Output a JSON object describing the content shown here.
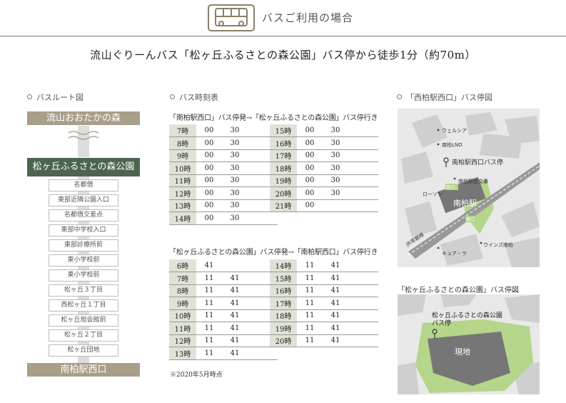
{
  "header": {
    "title": "バスご利用の場合"
  },
  "headline": "流山ぐりーんバス「松ヶ丘ふるさとの森公園」バス停から徒歩1分（約70m）",
  "route": {
    "title": "バスルート図",
    "start": "流山おおたかの森",
    "highlight": "松ヶ丘ふるさとの森公園",
    "stops": [
      "名都借",
      "東部近隣公園入口",
      "名都借交差点",
      "東部中学校入口",
      "東部診療所前",
      "東小学校前",
      "東小学校前",
      "松ヶ丘３丁目",
      "西松ヶ丘１丁目",
      "松ヶ丘旭会館前",
      "松ヶ丘２丁目",
      "松ヶ丘団地"
    ],
    "end": "南柏駅西口"
  },
  "timetable": {
    "title": "バス時刻表",
    "outbound_caption": "「南柏駅西口」バス停発→「松ヶ丘ふるさとの森公園」バス停行き",
    "outbound_left": [
      {
        "hour": "7時",
        "m1": "00",
        "m2": "30"
      },
      {
        "hour": "8時",
        "m1": "00",
        "m2": "30"
      },
      {
        "hour": "9時",
        "m1": "00",
        "m2": "30"
      },
      {
        "hour": "10時",
        "m1": "00",
        "m2": "30"
      },
      {
        "hour": "11時",
        "m1": "00",
        "m2": "30"
      },
      {
        "hour": "12時",
        "m1": "00",
        "m2": "30"
      },
      {
        "hour": "13時",
        "m1": "00",
        "m2": "30"
      },
      {
        "hour": "14時",
        "m1": "00",
        "m2": "30"
      }
    ],
    "outbound_right": [
      {
        "hour": "15時",
        "m1": "00",
        "m2": "30"
      },
      {
        "hour": "16時",
        "m1": "00",
        "m2": "30"
      },
      {
        "hour": "17時",
        "m1": "00",
        "m2": "30"
      },
      {
        "hour": "18時",
        "m1": "00",
        "m2": "30"
      },
      {
        "hour": "19時",
        "m1": "00",
        "m2": "30"
      },
      {
        "hour": "20時",
        "m1": "00",
        "m2": "30"
      },
      {
        "hour": "21時",
        "m1": "00",
        "m2": ""
      }
    ],
    "inbound_caption": "「松ヶ丘ふるさとの森公園」バス停発→「南柏駅西口」バス停行き",
    "inbound_left": [
      {
        "hour": "6時",
        "m1": "41",
        "m2": ""
      },
      {
        "hour": "7時",
        "m1": "11",
        "m2": "41"
      },
      {
        "hour": "8時",
        "m1": "11",
        "m2": "41"
      },
      {
        "hour": "9時",
        "m1": "11",
        "m2": "41"
      },
      {
        "hour": "10時",
        "m1": "11",
        "m2": "41"
      },
      {
        "hour": "11時",
        "m1": "11",
        "m2": "41"
      },
      {
        "hour": "12時",
        "m1": "11",
        "m2": "41"
      },
      {
        "hour": "13時",
        "m1": "11",
        "m2": "41"
      }
    ],
    "inbound_right": [
      {
        "hour": "14時",
        "m1": "11",
        "m2": "41"
      },
      {
        "hour": "15時",
        "m1": "11",
        "m2": "41"
      },
      {
        "hour": "16時",
        "m1": "11",
        "m2": "41"
      },
      {
        "hour": "17時",
        "m1": "11",
        "m2": "41"
      },
      {
        "hour": "18時",
        "m1": "11",
        "m2": "41"
      },
      {
        "hour": "19時",
        "m1": "11",
        "m2": "41"
      },
      {
        "hour": "20時",
        "m1": "11",
        "m2": "41"
      }
    ],
    "footnote": "※2020年5月時点"
  },
  "map1": {
    "title": "「西柏駅西口」バス停図",
    "labels": {
      "wellsia": "ウェルシア",
      "minamikashiwa_no": "南柏LNO",
      "bus_stop": "南柏駅西口バス停",
      "crossing": "南柏駅前交番",
      "lawson": "ローソン",
      "west": "西口",
      "station": "南柏駅",
      "east": "東口",
      "jr": "JR常磐線",
      "winds": "ウインズ南柏",
      "cuela": "キュア・ラ"
    }
  },
  "map2": {
    "title": "「松ヶ丘ふるさとの森公園」バス停図",
    "labels": {
      "stop_line1": "松ヶ丘ふるさとの森公園",
      "stop_line2": "バス停",
      "site": "現地"
    }
  },
  "colors": {
    "route_main": "#4d6451",
    "route_end": "#a89e8a",
    "hour_cell": "#dfe3d7",
    "park": "#b5d58a",
    "site": "#767676"
  }
}
